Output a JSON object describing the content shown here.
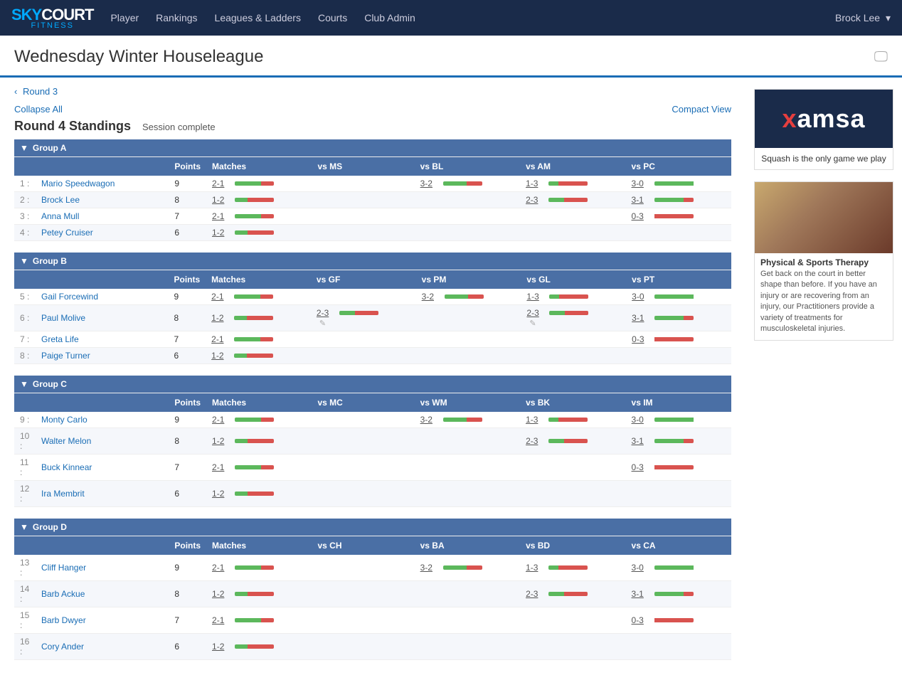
{
  "navbar": {
    "brand_sky": "SKY",
    "brand_court": "COURT",
    "brand_fitness": "FITNESS",
    "links": [
      {
        "label": "Player",
        "id": "player"
      },
      {
        "label": "Rankings",
        "id": "rankings"
      },
      {
        "label": "Leagues & Ladders",
        "id": "leagues"
      },
      {
        "label": "Courts",
        "id": "courts"
      },
      {
        "label": "Club Admin",
        "id": "clubadmin"
      }
    ],
    "user": "Brock Lee"
  },
  "page": {
    "title": "Wednesday Winter Houseleague"
  },
  "breadcrumb": {
    "prev_label": "Round 3"
  },
  "controls": {
    "collapse_label": "Collapse All",
    "compact_label": "Compact View"
  },
  "standings": {
    "title": "Round 4 Standings",
    "status": "Session complete"
  },
  "groups": [
    {
      "id": "A",
      "label": "Group A",
      "cols": [
        "Points",
        "Matches",
        "vs MS",
        "vs BL",
        "vs AM",
        "vs PC"
      ],
      "rows": [
        {
          "rank": "1",
          "name": "Mario Speedwagon",
          "points": "9",
          "matches": "2-1",
          "s1": "",
          "s2": "3-2",
          "s3": "1-3",
          "s4": "3-0"
        },
        {
          "rank": "2",
          "name": "Brock Lee",
          "points": "8",
          "matches": "1-2",
          "s1": "",
          "s2": "",
          "s3": "2-3",
          "s4": "3-1"
        },
        {
          "rank": "3",
          "name": "Anna Mull",
          "points": "7",
          "matches": "2-1",
          "s1": "",
          "s2": "",
          "s3": "",
          "s4": "0-3"
        },
        {
          "rank": "4",
          "name": "Petey Cruiser",
          "points": "6",
          "matches": "1-2",
          "s1": "",
          "s2": "",
          "s3": "",
          "s4": ""
        }
      ]
    },
    {
      "id": "B",
      "label": "Group B",
      "cols": [
        "Points",
        "Matches",
        "vs GF",
        "vs PM",
        "vs GL",
        "vs PT"
      ],
      "rows": [
        {
          "rank": "5",
          "name": "Gail Forcewind",
          "points": "9",
          "matches": "2-1",
          "s1": "",
          "s2": "3-2",
          "s3": "1-3",
          "s4": "3-0"
        },
        {
          "rank": "6",
          "name": "Paul Molive",
          "points": "8",
          "matches": "1-2",
          "s1": "2-3",
          "s2": "",
          "s3": "2-3",
          "s4": "3-1",
          "editable": true
        },
        {
          "rank": "7",
          "name": "Greta Life",
          "points": "7",
          "matches": "2-1",
          "s1": "",
          "s2": "",
          "s3": "",
          "s4": "0-3"
        },
        {
          "rank": "8",
          "name": "Paige Turner",
          "points": "6",
          "matches": "1-2",
          "s1": "",
          "s2": "",
          "s3": "",
          "s4": ""
        }
      ]
    },
    {
      "id": "C",
      "label": "Group C",
      "cols": [
        "Points",
        "Matches",
        "vs MC",
        "vs WM",
        "vs BK",
        "vs IM"
      ],
      "rows": [
        {
          "rank": "9",
          "name": "Monty Carlo",
          "points": "9",
          "matches": "2-1",
          "s1": "",
          "s2": "3-2",
          "s3": "1-3",
          "s4": "3-0"
        },
        {
          "rank": "10",
          "name": "Walter Melon",
          "points": "8",
          "matches": "1-2",
          "s1": "",
          "s2": "",
          "s3": "2-3",
          "s4": "3-1"
        },
        {
          "rank": "11",
          "name": "Buck Kinnear",
          "points": "7",
          "matches": "2-1",
          "s1": "",
          "s2": "",
          "s3": "",
          "s4": "0-3"
        },
        {
          "rank": "12",
          "name": "Ira Membrit",
          "points": "6",
          "matches": "1-2",
          "s1": "",
          "s2": "",
          "s3": "",
          "s4": ""
        }
      ]
    },
    {
      "id": "D",
      "label": "Group D",
      "cols": [
        "Points",
        "Matches",
        "vs CH",
        "vs BA",
        "vs BD",
        "vs CA"
      ],
      "rows": [
        {
          "rank": "13",
          "name": "Cliff Hanger",
          "points": "9",
          "matches": "2-1",
          "s1": "",
          "s2": "3-2",
          "s3": "1-3",
          "s4": "3-0"
        },
        {
          "rank": "14",
          "name": "Barb Ackue",
          "points": "8",
          "matches": "1-2",
          "s1": "",
          "s2": "",
          "s3": "2-3",
          "s4": "3-1"
        },
        {
          "rank": "15",
          "name": "Barb Dwyer",
          "points": "7",
          "matches": "2-1",
          "s1": "",
          "s2": "",
          "s3": "",
          "s4": "0-3"
        },
        {
          "rank": "16",
          "name": "Cory Ander",
          "points": "6",
          "matches": "1-2",
          "s1": "",
          "s2": "",
          "s3": "",
          "s4": ""
        }
      ]
    }
  ],
  "sidebar": {
    "ad1": {
      "logo": "xamsa",
      "tagline": "Squash is the only game we play"
    },
    "ad2": {
      "title": "Physical & Sports Therapy",
      "text": "Get back on the court in better shape than before. If you have an injury or are recovering from an injury, our Practitioners provide a variety of treatments for musculoskeletal injuries."
    }
  }
}
